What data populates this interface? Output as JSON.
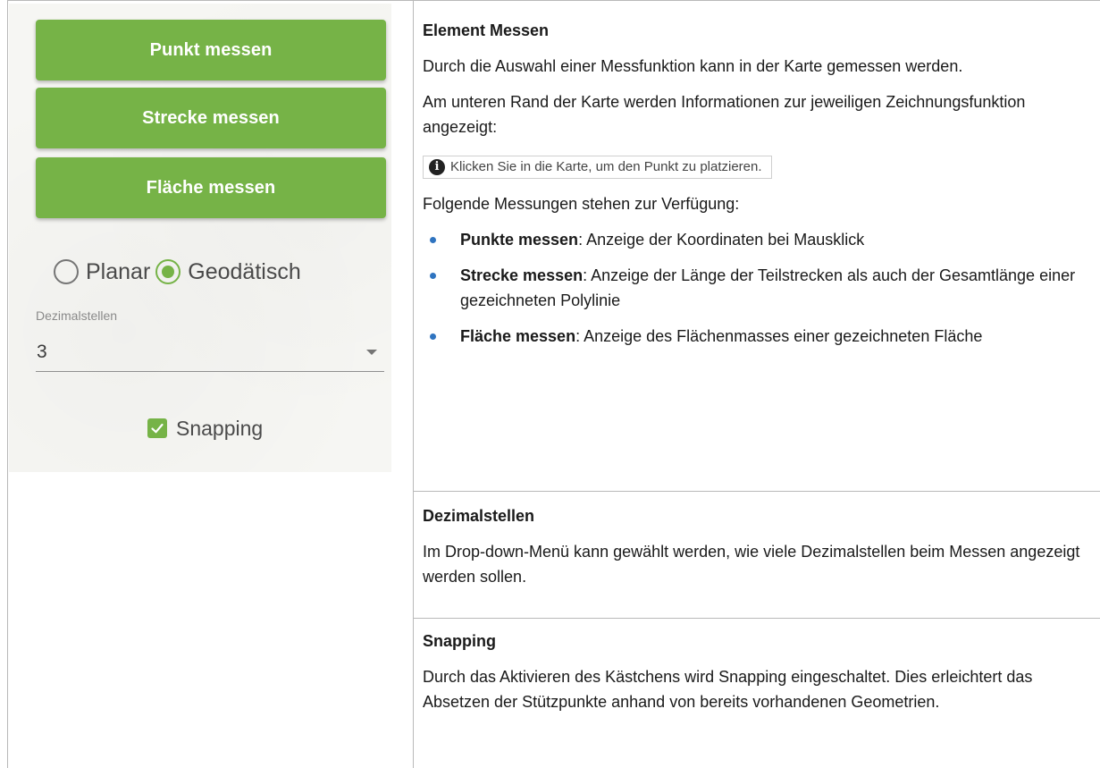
{
  "left_panel": {
    "buttons": [
      "Punkt messen",
      "Strecke messen",
      "Fläche messen"
    ],
    "radio": {
      "options": [
        "Planar",
        "Geodätisch"
      ],
      "selected": "Geodätisch"
    },
    "decimals": {
      "label": "Dezimalstellen",
      "value": "3"
    },
    "snapping": {
      "label": "Snapping",
      "checked": true
    },
    "accent_color": "#76b347"
  },
  "sections": [
    {
      "title": "Element Messen",
      "paragraphs": [
        "Durch die Auswahl einer Messfunktion kann in der Karte gemessen werden.",
        "Am unteren Rand der Karte werden Informationen zur jeweiligen Zeichnungsfunktion angezeigt:"
      ],
      "info_box": "Klicken Sie in die Karte, um den Punkt zu platzieren.",
      "list_intro": "Folgende Messungen stehen zur Verfügung:",
      "items": [
        {
          "term": "Punkte messen",
          "text": ": Anzeige der Koordinaten bei Mausklick"
        },
        {
          "term": "Strecke messen",
          "text": ": Anzeige der Länge der Teilstrecken als auch der Gesamtlänge einer gezeichneten Polylinie"
        },
        {
          "term": "Fläche messen",
          "text": ": Anzeige des Flächenmasses einer gezeichneten Fläche"
        }
      ]
    },
    {
      "title": "Dezimalstellen",
      "paragraphs": [
        "Im Drop-down-Menü kann gewählt werden, wie viele Dezimalstellen beim Messen angezeigt werden sollen."
      ]
    },
    {
      "title": "Snapping",
      "paragraphs": [
        "Durch das Aktivieren des Kästchens wird Snapping eingeschaltet. Dies erleichtert das Absetzen der Stützpunkte anhand von bereits vorhandenen Geometrien."
      ]
    }
  ]
}
